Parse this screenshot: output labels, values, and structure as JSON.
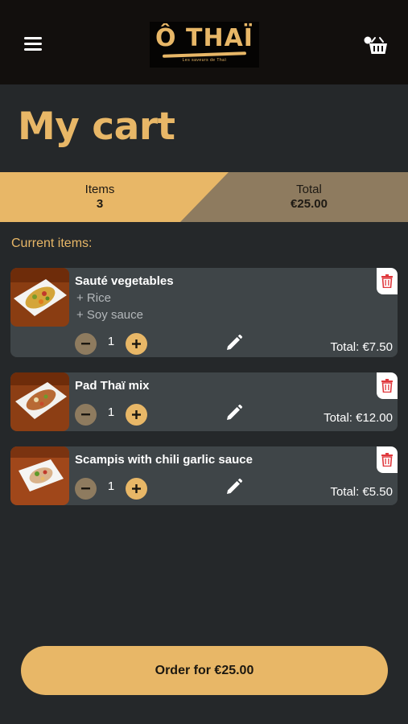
{
  "header": {
    "logo_text": "Ô THAÏ",
    "logo_tagline": "Les saveurs de Thaï"
  },
  "page": {
    "title": "My cart",
    "section_label": "Current items:"
  },
  "summary": {
    "items_label": "Items",
    "items_value": "3",
    "total_label": "Total",
    "total_value": "€25.00"
  },
  "cart_items": [
    {
      "name": "Sauté vegetables",
      "options": [
        "+ Rice",
        "+ Soy sauce"
      ],
      "quantity": "1",
      "total": "Total: €7.50"
    },
    {
      "name": "Pad Thaï mix",
      "options": [],
      "quantity": "1",
      "total": "Total: €12.00"
    },
    {
      "name": "Scampis with chili garlic sauce",
      "options": [],
      "quantity": "1",
      "total": "Total: €5.50"
    }
  ],
  "order_button": {
    "label": "Order for €25.00"
  },
  "icons": {
    "menu": "hamburger-icon",
    "cart": "basket-icon",
    "delete": "trash-icon",
    "decrement": "minus-icon",
    "increment": "plus-icon",
    "edit": "pencil-icon"
  },
  "colors": {
    "accent": "#e8b767",
    "background": "#25282a",
    "card": "#3f4548",
    "topbar": "#120f0d",
    "delete": "#e0393e"
  }
}
